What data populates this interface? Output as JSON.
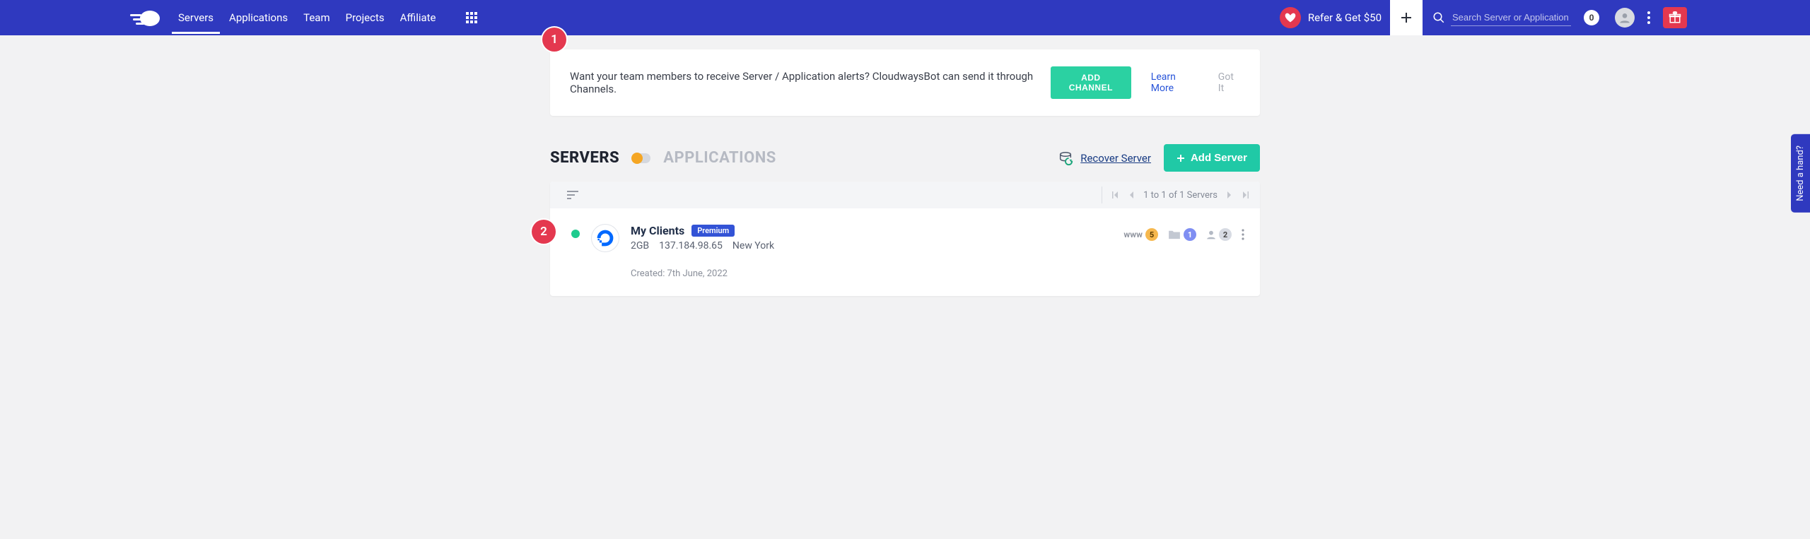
{
  "header": {
    "nav": {
      "servers": "Servers",
      "applications": "Applications",
      "team": "Team",
      "projects": "Projects",
      "affiliate": "Affiliate"
    },
    "refer_label": "Refer & Get $50",
    "search_placeholder": "Search Server or Application",
    "notif_count": "0"
  },
  "info_banner": {
    "text": "Want your team members to receive Server / Application alerts? CloudwaysBot can send it through Channels.",
    "add_channel": "ADD CHANNEL",
    "learn_more": "Learn More",
    "got_it": "Got It"
  },
  "tabs": {
    "servers": "SERVERS",
    "applications": "APPLICATIONS",
    "recover": "Recover Server",
    "add_server": "Add Server"
  },
  "panel": {
    "pager_text": "1 to 1 of 1 Servers"
  },
  "server": {
    "name": "My Clients",
    "badge": "Premium",
    "ram": "2GB",
    "ip": "137.184.98.65",
    "location": "New York",
    "created": "Created: 7th June, 2022",
    "counts": {
      "www": "www",
      "www_n": "5",
      "folder_n": "1",
      "users_n": "2"
    }
  },
  "markers": {
    "one": "1",
    "two": "2"
  },
  "help": "Need a hand?"
}
